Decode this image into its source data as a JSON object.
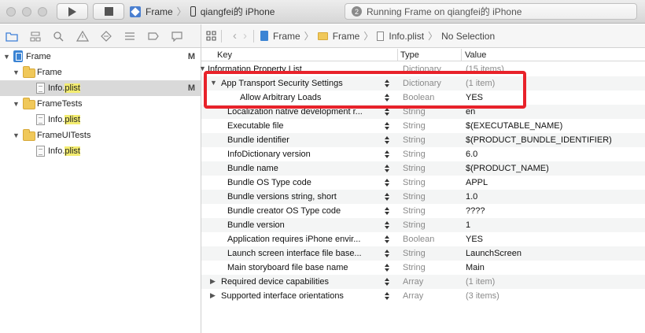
{
  "toolbar": {
    "scheme_name": "Frame",
    "device_name": "qiangfei的 iPhone",
    "activity_badge": "2",
    "activity_text": "Running Frame on qiangfei的 iPhone"
  },
  "navigator": {
    "items": [
      {
        "label": "Frame",
        "flag": "M"
      },
      {
        "label": "Frame",
        "flag": ""
      },
      {
        "label": "Info.",
        "ext": "plist",
        "flag": "M"
      },
      {
        "label": "FrameTests",
        "flag": ""
      },
      {
        "label": "Info.",
        "ext": "plist",
        "flag": ""
      },
      {
        "label": "FrameUITests",
        "flag": ""
      },
      {
        "label": "Info.",
        "ext": "plist",
        "flag": ""
      }
    ]
  },
  "jumpbar": {
    "crumbs": [
      "Frame",
      "Frame",
      "Info.plist",
      "No Selection"
    ]
  },
  "plist": {
    "headers": {
      "key": "Key",
      "type": "Type",
      "value": "Value"
    },
    "rows": [
      {
        "key": "Information Property List",
        "type": "Dictionary",
        "value": "(15 items)"
      },
      {
        "key": "App Transport Security Settings",
        "type": "Dictionary",
        "value": "(1 item)"
      },
      {
        "key": "Allow Arbitrary Loads",
        "type": "Boolean",
        "value": "YES"
      },
      {
        "key": "Localization native development r...",
        "type": "String",
        "value": "en"
      },
      {
        "key": "Executable file",
        "type": "String",
        "value": "$(EXECUTABLE_NAME)"
      },
      {
        "key": "Bundle identifier",
        "type": "String",
        "value": "$(PRODUCT_BUNDLE_IDENTIFIER)"
      },
      {
        "key": "InfoDictionary version",
        "type": "String",
        "value": "6.0"
      },
      {
        "key": "Bundle name",
        "type": "String",
        "value": "$(PRODUCT_NAME)"
      },
      {
        "key": "Bundle OS Type code",
        "type": "String",
        "value": "APPL"
      },
      {
        "key": "Bundle versions string, short",
        "type": "String",
        "value": "1.0"
      },
      {
        "key": "Bundle creator OS Type code",
        "type": "String",
        "value": "????"
      },
      {
        "key": "Bundle version",
        "type": "String",
        "value": "1"
      },
      {
        "key": "Application requires iPhone envir...",
        "type": "Boolean",
        "value": "YES"
      },
      {
        "key": "Launch screen interface file base...",
        "type": "String",
        "value": "LaunchScreen"
      },
      {
        "key": "Main storyboard file base name",
        "type": "String",
        "value": "Main"
      },
      {
        "key": "Required device capabilities",
        "type": "Array",
        "value": "(1 item)"
      },
      {
        "key": "Supported interface orientations",
        "type": "Array",
        "value": "(3 items)"
      }
    ]
  },
  "colors": {
    "highlight": "#e8222a",
    "plist_ext_highlight": "#f3ec70",
    "selection": "#d9d9d9"
  }
}
